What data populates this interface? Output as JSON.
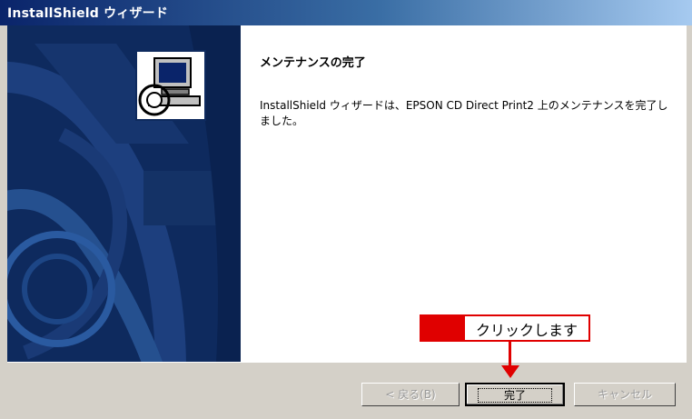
{
  "window": {
    "title": "InstallShield ウィザード"
  },
  "wizard": {
    "heading": "メンテナンスの完了",
    "message": "InstallShield ウィザードは、EPSON CD Direct Print2 上のメンテナンスを完了しました。"
  },
  "buttons": {
    "back": "< 戻る(B)",
    "finish": "完了",
    "cancel": "キャンセル"
  },
  "annotation": {
    "callout_text": "クリックします",
    "color": "#e00000"
  },
  "icons": {
    "app_icon": "installer-computer-icon",
    "side_graphic": "installshield-swirl-graphic"
  }
}
